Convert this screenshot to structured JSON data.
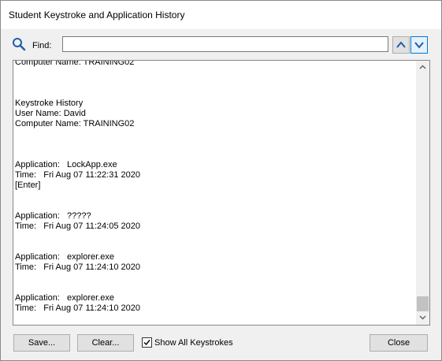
{
  "window": {
    "title": "Student Keystroke and Application History"
  },
  "find": {
    "label": "Find:",
    "value": "",
    "up_icon": "chevron-up-icon",
    "down_icon": "chevron-down-icon",
    "search_icon": "search-icon"
  },
  "log": {
    "text": "Computer Name: TRAINING02\n\n\n\nKeystroke History\nUser Name: David\nComputer Name: TRAINING02\n\n\n\nApplication:   LockApp.exe\nTime:   Fri Aug 07 11:22:31 2020\n[Enter]\n\n\nApplication:   ?????\nTime:   Fri Aug 07 11:24:05 2020\n\n\nApplication:   explorer.exe\nTime:   Fri Aug 07 11:24:10 2020\n\n\nApplication:   explorer.exe\nTime:   Fri Aug 07 11:24:10 2020"
  },
  "buttons": {
    "save": "Save...",
    "clear": "Clear...",
    "close": "Close"
  },
  "show_all": {
    "label": "Show All Keystrokes",
    "checked": true
  },
  "colors": {
    "accent": "#0078d7",
    "icon": "#1e5fa8"
  }
}
